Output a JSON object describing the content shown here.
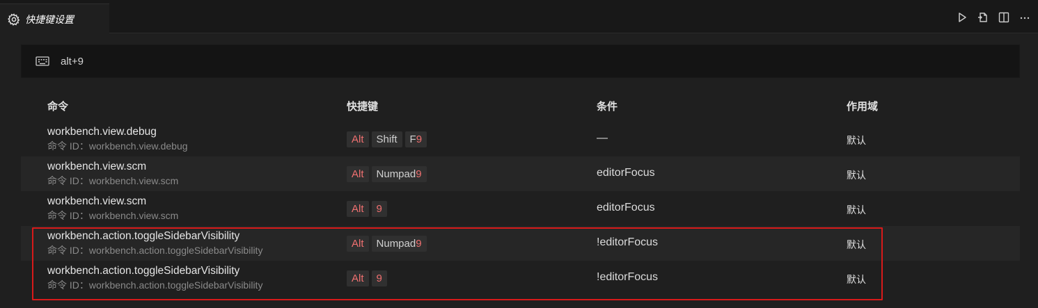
{
  "tab": {
    "title": "快捷键设置",
    "icon": "gear-icon"
  },
  "actions": [
    {
      "name": "run-icon"
    },
    {
      "name": "open-json-icon"
    },
    {
      "name": "split-editor-icon"
    },
    {
      "name": "more-icon"
    }
  ],
  "search": {
    "value": "alt+9",
    "icon": "keyboard-icon"
  },
  "columns": {
    "command": "命令",
    "keybinding": "快捷键",
    "when": "条件",
    "source": "作用域"
  },
  "rows": [
    {
      "name": "workbench.view.debug",
      "id": "命令 ID：workbench.view.debug",
      "keys": [
        "Alt",
        "Shift",
        "F9"
      ],
      "when": "—",
      "source": "默认"
    },
    {
      "name": "workbench.view.scm",
      "id": "命令 ID：workbench.view.scm",
      "keys": [
        "Alt",
        "Numpad9"
      ],
      "when": "editorFocus",
      "source": "默认"
    },
    {
      "name": "workbench.view.scm",
      "id": "命令 ID：workbench.view.scm",
      "keys": [
        "Alt",
        "9"
      ],
      "when": "editorFocus",
      "source": "默认"
    },
    {
      "name": "workbench.action.toggleSidebarVisibility",
      "id": "命令 ID：workbench.action.toggleSidebarVisibility",
      "keys": [
        "Alt",
        "Numpad9"
      ],
      "when": "!editorFocus",
      "source": "默认"
    },
    {
      "name": "workbench.action.toggleSidebarVisibility",
      "id": "命令 ID：workbench.action.toggleSidebarVisibility",
      "keys": [
        "Alt",
        "9"
      ],
      "when": "!editorFocus",
      "source": "默认"
    }
  ],
  "colors": {
    "highlight": "#f07070",
    "annotation_box": "#d81a1a",
    "background": "#1f1f1f"
  }
}
